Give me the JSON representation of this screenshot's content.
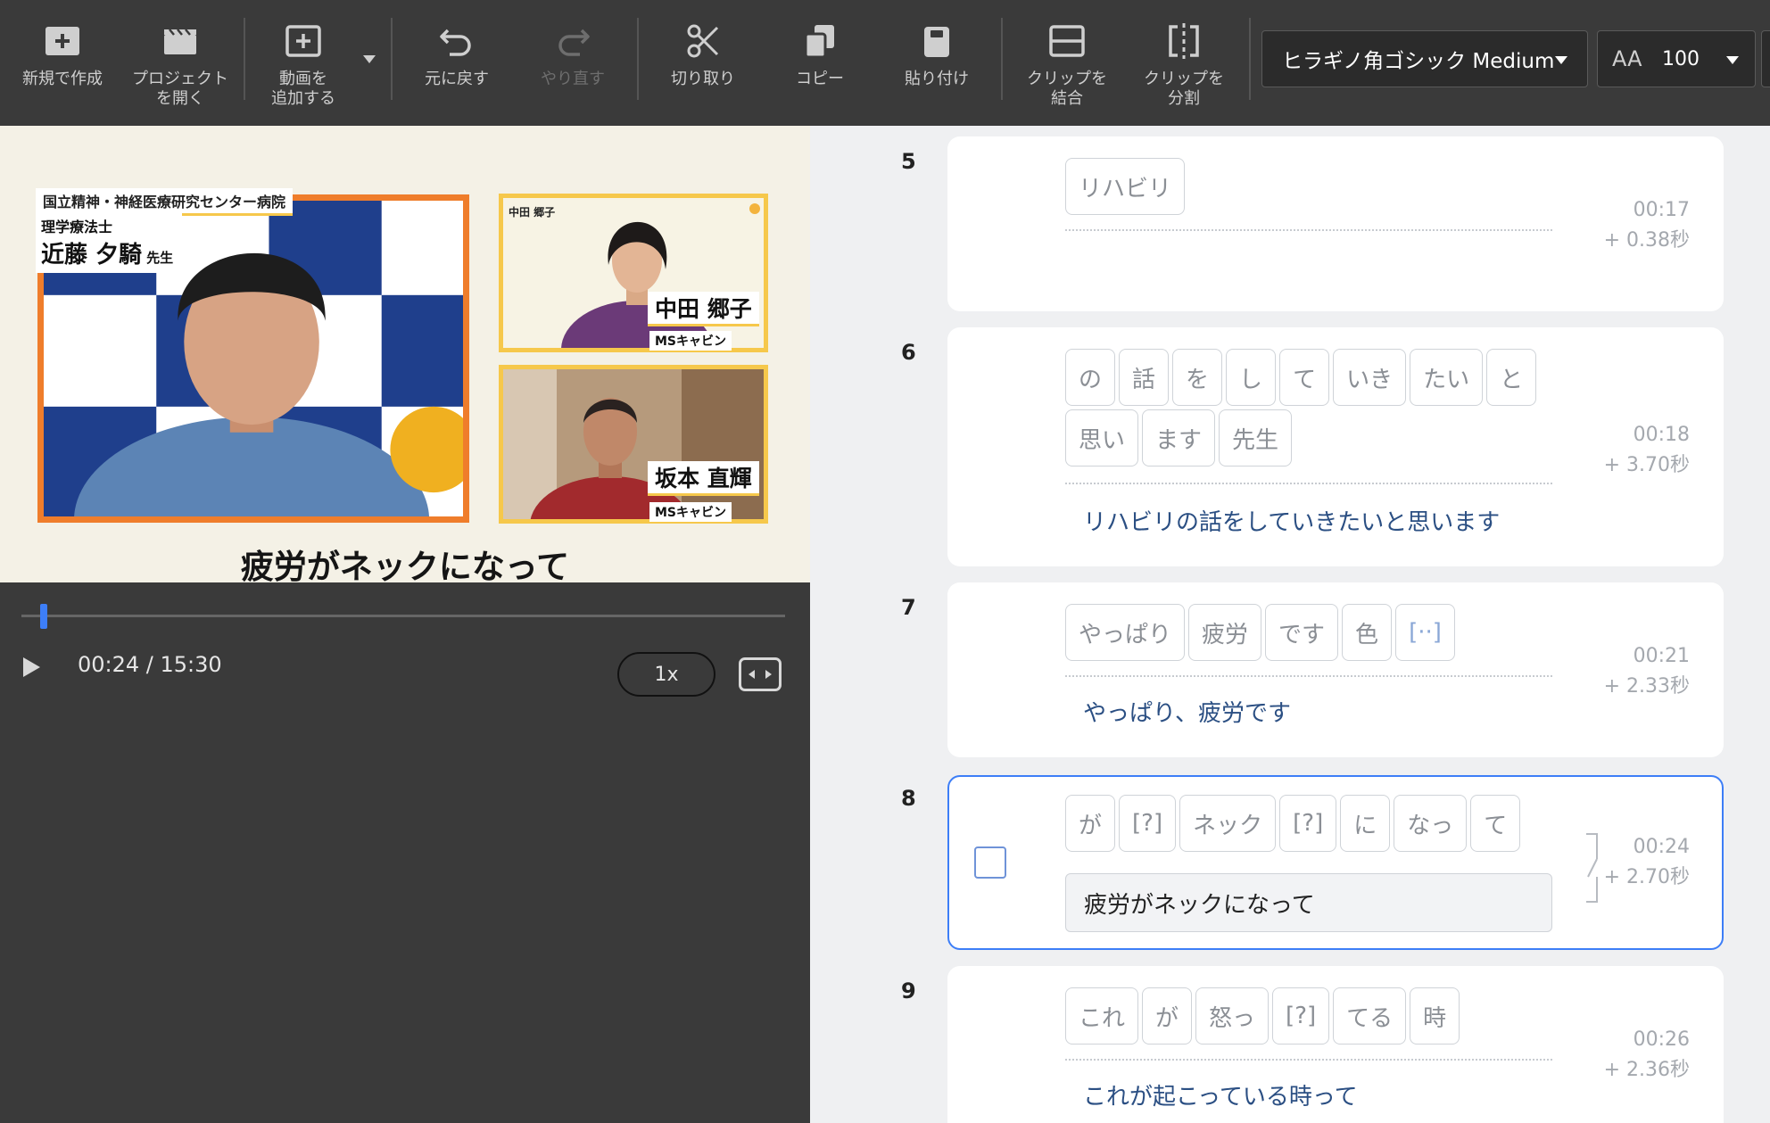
{
  "toolbar": {
    "new_label": "新規で作成",
    "open_label_1": "プロジェクト",
    "open_label_2": "を開く",
    "addvideo_label_1": "動画を",
    "addvideo_label_2": "追加する",
    "undo_label": "元に戻す",
    "redo_label": "やり直す",
    "cut_label": "切り取り",
    "copy_label": "コピー",
    "paste_label": "貼り付け",
    "merge_label_1": "クリップを",
    "merge_label_2": "結合",
    "split_label_1": "クリップを",
    "split_label_2": "分割",
    "font_value": "ヒラギノ角ゴシック Medium",
    "size_icon": "AA",
    "size_value": "100"
  },
  "preview": {
    "hospital": "国立精神・神経医療研究センター病院",
    "main_role": "理学療法士",
    "main_name": "近藤 夕騎",
    "main_suffix": "先生",
    "sub1_name": "中田 郷子",
    "sub1_tag": "MSキャビン",
    "sub1_small": "中田 郷子",
    "sub2_name": "坂本 直輝",
    "sub2_tag": "MSキャビン",
    "caption": "疲労がネックになって",
    "time": "00:24 / 15:30",
    "speed": "1x"
  },
  "colors": {
    "accent": "#3d7ef7",
    "orange_frame": "#ef7d2b",
    "yellow_frame": "#f6c84b",
    "text_blue": "#2b4f83"
  },
  "rows": [
    {
      "num": "5",
      "tokens": [
        "リハビリ"
      ],
      "time": "00:17",
      "duration": "+ 0.38秒",
      "text": ""
    },
    {
      "num": "6",
      "tokens": [
        "の",
        "話",
        "を",
        "し",
        "て",
        "いき",
        "たい",
        "と",
        "思い",
        "ます",
        "先生"
      ],
      "time": "00:18",
      "duration": "+ 3.70秒",
      "text": "リハビリの話をしていきたいと思います"
    },
    {
      "num": "7",
      "tokens": [
        "やっぱり",
        "疲労",
        "です",
        "色",
        "[··]"
      ],
      "time": "00:21",
      "duration": "+ 2.33秒",
      "text": "やっぱり、疲労です"
    },
    {
      "num": "8",
      "tokens": [
        "が",
        "[?]",
        "ネック",
        "[?]",
        "に",
        "なっ",
        "て"
      ],
      "time": "00:24",
      "duration": "+ 2.70秒",
      "text": "疲労がネックになって"
    },
    {
      "num": "9",
      "tokens": [
        "これ",
        "が",
        "怒っ",
        "[?]",
        "てる",
        "時"
      ],
      "time": "00:26",
      "duration": "+ 2.36秒",
      "text": "これが起こっている時って"
    }
  ]
}
